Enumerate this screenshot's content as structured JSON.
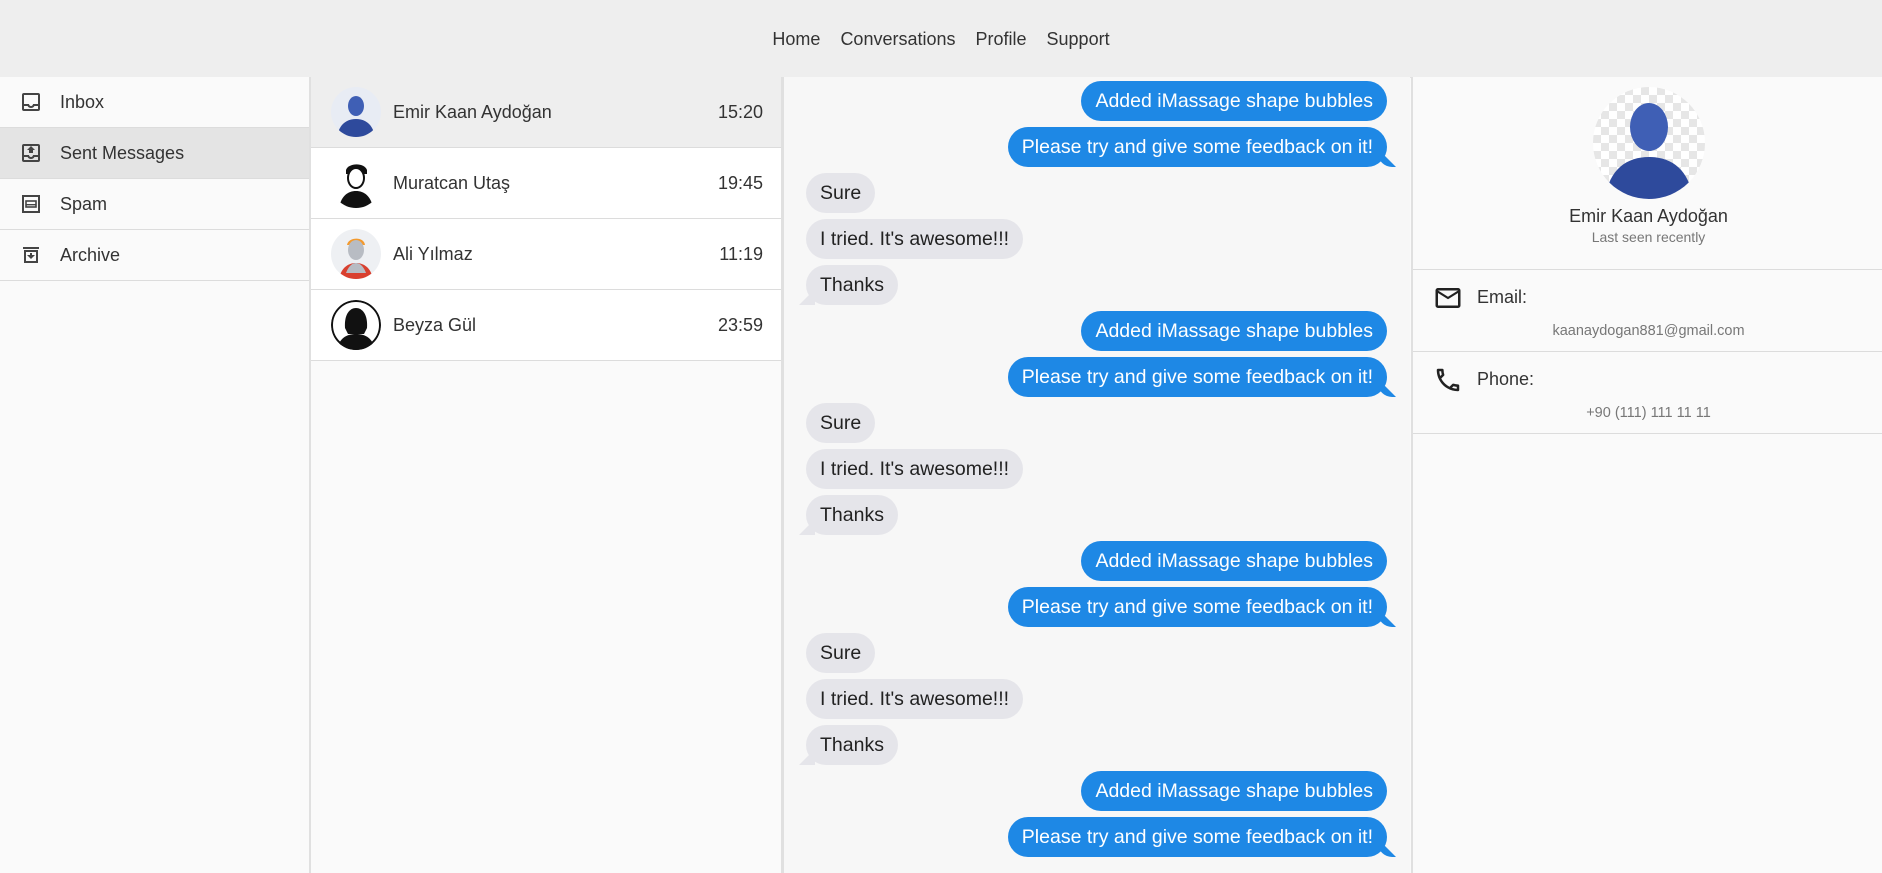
{
  "nav": {
    "links": [
      "Home",
      "Conversations",
      "Profile",
      "Support"
    ]
  },
  "sidebar": {
    "items": [
      {
        "label": "Inbox",
        "icon": "inbox-icon",
        "active": false
      },
      {
        "label": "Sent Messages",
        "icon": "outbox-icon",
        "active": true
      },
      {
        "label": "Spam",
        "icon": "spam-icon",
        "active": false
      },
      {
        "label": "Archive",
        "icon": "archive-icon",
        "active": false
      }
    ]
  },
  "conversations": [
    {
      "name": "Emir Kaan Aydoğan",
      "time": "15:20",
      "avatar": "avatar-blue-icon",
      "active": true
    },
    {
      "name": "Muratcan Utaş",
      "time": "19:45",
      "avatar": "avatar-man-outline-icon",
      "active": false
    },
    {
      "name": "Ali Yılmaz",
      "time": "11:19",
      "avatar": "avatar-orange-hair-icon",
      "active": false
    },
    {
      "name": "Beyza Gül",
      "time": "23:59",
      "avatar": "avatar-woman-silhouette-icon",
      "active": false
    }
  ],
  "messages": [
    {
      "dir": "out",
      "text": "Added iMassage shape bubbles"
    },
    {
      "dir": "out",
      "text": "Please try and give some feedback on it!",
      "tail": true
    },
    {
      "dir": "in",
      "text": "Sure"
    },
    {
      "dir": "in",
      "text": "I tried. It's awesome!!!"
    },
    {
      "dir": "in",
      "text": "Thanks",
      "tail": true
    },
    {
      "dir": "out",
      "text": "Added iMassage shape bubbles"
    },
    {
      "dir": "out",
      "text": "Please try and give some feedback on it!",
      "tail": true
    },
    {
      "dir": "in",
      "text": "Sure"
    },
    {
      "dir": "in",
      "text": "I tried. It's awesome!!!"
    },
    {
      "dir": "in",
      "text": "Thanks",
      "tail": true
    },
    {
      "dir": "out",
      "text": "Added iMassage shape bubbles"
    },
    {
      "dir": "out",
      "text": "Please try and give some feedback on it!",
      "tail": true
    },
    {
      "dir": "in",
      "text": "Sure"
    },
    {
      "dir": "in",
      "text": "I tried. It's awesome!!!"
    },
    {
      "dir": "in",
      "text": "Thanks",
      "tail": true
    },
    {
      "dir": "out",
      "text": "Added iMassage shape bubbles"
    },
    {
      "dir": "out",
      "text": "Please try and give some feedback on it!",
      "tail": true
    }
  ],
  "profile": {
    "name": "Emir Kaan Aydoğan",
    "status": "Last seen recently",
    "email_label": "Email:",
    "email": "kaanaydogan881@gmail.com",
    "phone_label": "Phone:",
    "phone": "+90 (111) 111 11 11"
  },
  "colors": {
    "accent": "#1e88e5",
    "incoming_bubble": "#e5e5ea",
    "topbar": "#eeeeee"
  }
}
